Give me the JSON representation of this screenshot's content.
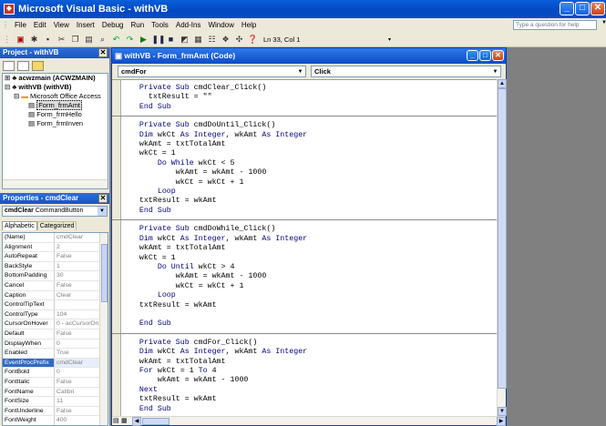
{
  "window": {
    "title": "Microsoft Visual Basic - withVB"
  },
  "menu": [
    "File",
    "Edit",
    "View",
    "Insert",
    "Debug",
    "Run",
    "Tools",
    "Add-Ins",
    "Window",
    "Help"
  ],
  "help_box": {
    "placeholder": "Type a question for help"
  },
  "toolbar": {
    "position": "Ln 33, Col 1"
  },
  "project": {
    "title": "Project - withVB",
    "tree": [
      "acwzmain (ACWZMAIN)",
      "withVB (withVB)",
      "Microsoft Office Access",
      "Form_frmAmt",
      "Form_frmHello",
      "Form_frmInven"
    ]
  },
  "properties": {
    "title": "Properties - cmdClear",
    "object": "cmdClear",
    "object_type": "CommandButton",
    "tabs": [
      "Alphabetic",
      "Categorized"
    ],
    "rows": [
      [
        "(Name)",
        "cmdClear"
      ],
      [
        "Alignment",
        "2"
      ],
      [
        "AutoRepeat",
        "False"
      ],
      [
        "BackStyle",
        "1"
      ],
      [
        "BottomPadding",
        "30"
      ],
      [
        "Cancel",
        "False"
      ],
      [
        "Caption",
        "Clear"
      ],
      [
        "ControlTipText",
        ""
      ],
      [
        "ControlType",
        "104"
      ],
      [
        "CursorOnHover",
        "0 - acCursorOn"
      ],
      [
        "Default",
        "False"
      ],
      [
        "DisplayWhen",
        "0"
      ],
      [
        "Enabled",
        "True"
      ],
      [
        "EventProcPrefix",
        "cmdClear"
      ],
      [
        "FontBold",
        "0"
      ],
      [
        "FontItalic",
        "False"
      ],
      [
        "FontName",
        "Calibri"
      ],
      [
        "FontSize",
        "11"
      ],
      [
        "FontUnderline",
        "False"
      ],
      [
        "FontWeight",
        "400"
      ]
    ]
  },
  "code_window": {
    "title": "withVB - Form_frmAmt (Code)",
    "object": "cmdFor",
    "procedure": "Click",
    "blocks": [
      [
        "    Private Sub cmdClear_Click()",
        "      txtResult = \"\"",
        "    End Sub"
      ],
      [
        "    Private Sub cmdDoUntil_Click()",
        "    Dim wkCt As Integer, wkAmt As Integer",
        "    wkAmt = txtTotalAmt",
        "    wkCt = 1",
        "        Do While wkCt < 5",
        "            wkAmt = wkAmt - 1000",
        "            wkCt = wkCt + 1",
        "        Loop",
        "    txtResult = wkAmt",
        "    End Sub"
      ],
      [
        "    Private Sub cmdDoWhile_Click()",
        "    Dim wkCt As Integer, wkAmt As Integer",
        "    wkAmt = txtTotalAmt",
        "    wkCt = 1",
        "        Do Until wkCt > 4",
        "            wkAmt = wkAmt - 1000",
        "            wkCt = wkCt + 1",
        "        Loop",
        "    txtResult = wkAmt",
        "",
        "    End Sub"
      ],
      [
        "    Private Sub cmdFor_Click()",
        "    Dim wkCt As Integer, wkAmt As Integer",
        "    wkAmt = txtTotalAmt",
        "    For wkCt = 1 To 4",
        "        wkAmt = wkAmt - 1000",
        "    Next",
        "    txtResult = wkAmt",
        "    End Sub"
      ]
    ]
  }
}
